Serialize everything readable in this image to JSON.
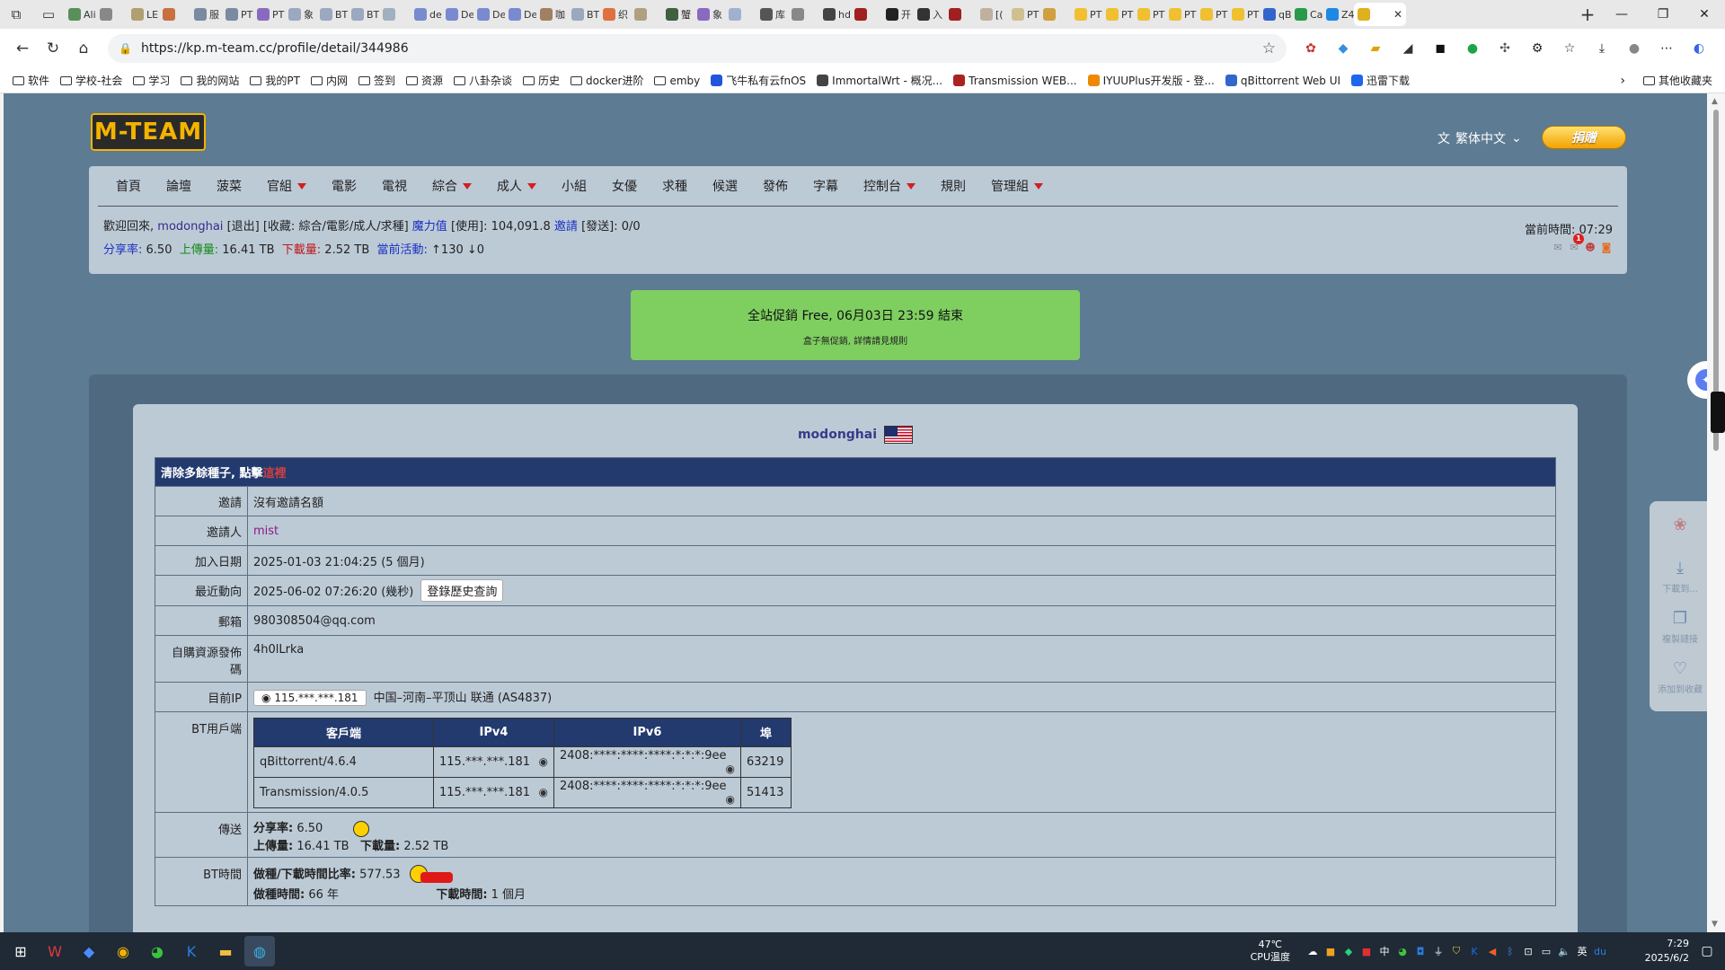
{
  "browser": {
    "url": "https://kp.m-team.cc/profile/detail/344986",
    "tabs": [
      "Ali",
      "",
      "LEI",
      "",
      "服",
      "PT",
      "PT",
      "象",
      "BT",
      "BT",
      "",
      "de",
      "De",
      "De",
      "De",
      "咖",
      "BT",
      "织",
      "",
      "蟹",
      "象",
      "",
      "库",
      "",
      "hd",
      "",
      "开",
      "入",
      "",
      "[(",
      "PT",
      "",
      "PT",
      "PT",
      "PT",
      "PT",
      "PT",
      "PT",
      "qB",
      "Ca",
      "Z4",
      ""
    ],
    "bookmarks": [
      {
        "label": "软件",
        "kind": "folder"
      },
      {
        "label": "学校-社会",
        "kind": "folder"
      },
      {
        "label": "学习",
        "kind": "folder"
      },
      {
        "label": "我的网站",
        "kind": "folder"
      },
      {
        "label": "我的PT",
        "kind": "folder"
      },
      {
        "label": "内网",
        "kind": "folder"
      },
      {
        "label": "签到",
        "kind": "folder"
      },
      {
        "label": "资源",
        "kind": "folder"
      },
      {
        "label": "八卦杂谈",
        "kind": "folder"
      },
      {
        "label": "历史",
        "kind": "folder"
      },
      {
        "label": "docker进阶",
        "kind": "folder"
      },
      {
        "label": "emby",
        "kind": "folder"
      },
      {
        "label": "飞牛私有云fnOS",
        "kind": "site",
        "color": "#2255dd"
      },
      {
        "label": "ImmortalWrt - 概况...",
        "kind": "site",
        "color": "#444444"
      },
      {
        "label": "Transmission WEB...",
        "kind": "site",
        "color": "#aa2222"
      },
      {
        "label": "IYUUPlus开发版 - 登...",
        "kind": "site",
        "color": "#ee8800"
      },
      {
        "label": "qBittorrent Web UI",
        "kind": "site",
        "color": "#3366cc"
      },
      {
        "label": "迅雷下载",
        "kind": "site",
        "color": "#1e66ee"
      }
    ],
    "other_bookmarks": "其他收藏夹"
  },
  "site": {
    "logo_text": "M-TEAM",
    "language": "繁体中文",
    "donate": "捐贈",
    "nav": [
      {
        "label": "首頁",
        "dropdown": false
      },
      {
        "label": "論壇",
        "dropdown": false
      },
      {
        "label": "菠菜",
        "dropdown": false
      },
      {
        "label": "官組",
        "dropdown": true
      },
      {
        "label": "電影",
        "dropdown": false
      },
      {
        "label": "電視",
        "dropdown": false
      },
      {
        "label": "綜合",
        "dropdown": true
      },
      {
        "label": "成人",
        "dropdown": true
      },
      {
        "label": "小組",
        "dropdown": false
      },
      {
        "label": "女優",
        "dropdown": false
      },
      {
        "label": "求種",
        "dropdown": false
      },
      {
        "label": "候選",
        "dropdown": false
      },
      {
        "label": "發佈",
        "dropdown": false
      },
      {
        "label": "字幕",
        "dropdown": false
      },
      {
        "label": "控制台",
        "dropdown": true
      },
      {
        "label": "規則",
        "dropdown": false
      },
      {
        "label": "管理組",
        "dropdown": true
      }
    ],
    "status": {
      "welcome": "歡迎回來,",
      "username": "modonghai",
      "logout": "[退出]",
      "favorites": "[收藏: 綜合/電影/成人/求種]",
      "bonus_label": "魔力值",
      "bonus_value": "[使用]: 104,091.8",
      "invite_label": "邀請",
      "invite_value": "[發送]: 0/0",
      "ratio_label": "分享率:",
      "ratio_value": "6.50",
      "upload_label": "上傳量:",
      "upload_value": "16.41 TB",
      "download_label": "下載量:",
      "download_value": "2.52 TB",
      "activity_label": "當前活動:",
      "activity_value": "↑130 ↓0",
      "time_label": "當前時間:",
      "time_value": "07:29",
      "notify_count": "1"
    },
    "promo": {
      "title": "全站促銷 Free, 06月03日 23:59 結束",
      "subtitle": "盒子無促銷, 詳情請見規則"
    }
  },
  "profile": {
    "username": "modonghai",
    "notice": "清除多餘種子, 點擊",
    "notice_link": "這裡",
    "rows": {
      "invite_label": "邀請",
      "invite_value": "沒有邀請名額",
      "inviter_label": "邀請人",
      "inviter_value": "mist",
      "join_label": "加入日期",
      "join_value": "2025-01-03 21:04:25 (5 個月)",
      "last_label": "最近動向",
      "last_value": "2025-06-02 07:26:20 (幾秒)",
      "login_history_btn": "登錄歷史查詢",
      "email_label": "郵箱",
      "email_value": "980308504@qq.com",
      "code_label": "自購資源發佈碼",
      "code_value": "4h0lLrka",
      "ip_label": "目前IP",
      "ip_value": "115.***.***.181",
      "ip_location": "中国–河南–平顶山 联通 (AS4837)",
      "bt_label": "BT用戶端",
      "transfer_label": "傳送",
      "ratio_label": "分享率:",
      "ratio_value": "6.50",
      "up_label": "上傳量:",
      "up_value": "16.41 TB",
      "down_label": "下載量:",
      "down_value": "2.52 TB",
      "bttime_label": "BT時間",
      "seedratio_label": "做種/下載時間比率:",
      "seedratio_value": "577.53",
      "seedtime_label": "做種時間:",
      "seedtime_value": "66 年",
      "dltime_label": "下載時間:",
      "dltime_value": "1 個月"
    },
    "clients_table": {
      "headers": [
        "客戶端",
        "IPv4",
        "IPv6",
        "埠"
      ],
      "rows": [
        [
          "qBittorrent/4.6.4",
          "115.***.***.181",
          "2408:****:****:****:*:*:*:9ee",
          "63219"
        ],
        [
          "Transmission/4.0.5",
          "115.***.***.181",
          "2408:****:****:****:*:*:*:9ee",
          "51413"
        ]
      ]
    }
  },
  "float_panel": [
    "",
    "下載到...",
    "複製鏈接",
    "添加到收藏"
  ],
  "taskbar": {
    "temp": "47℃",
    "temp_label": "CPU温度",
    "ime": "英",
    "time": "7:29",
    "date": "2025/6/2"
  }
}
